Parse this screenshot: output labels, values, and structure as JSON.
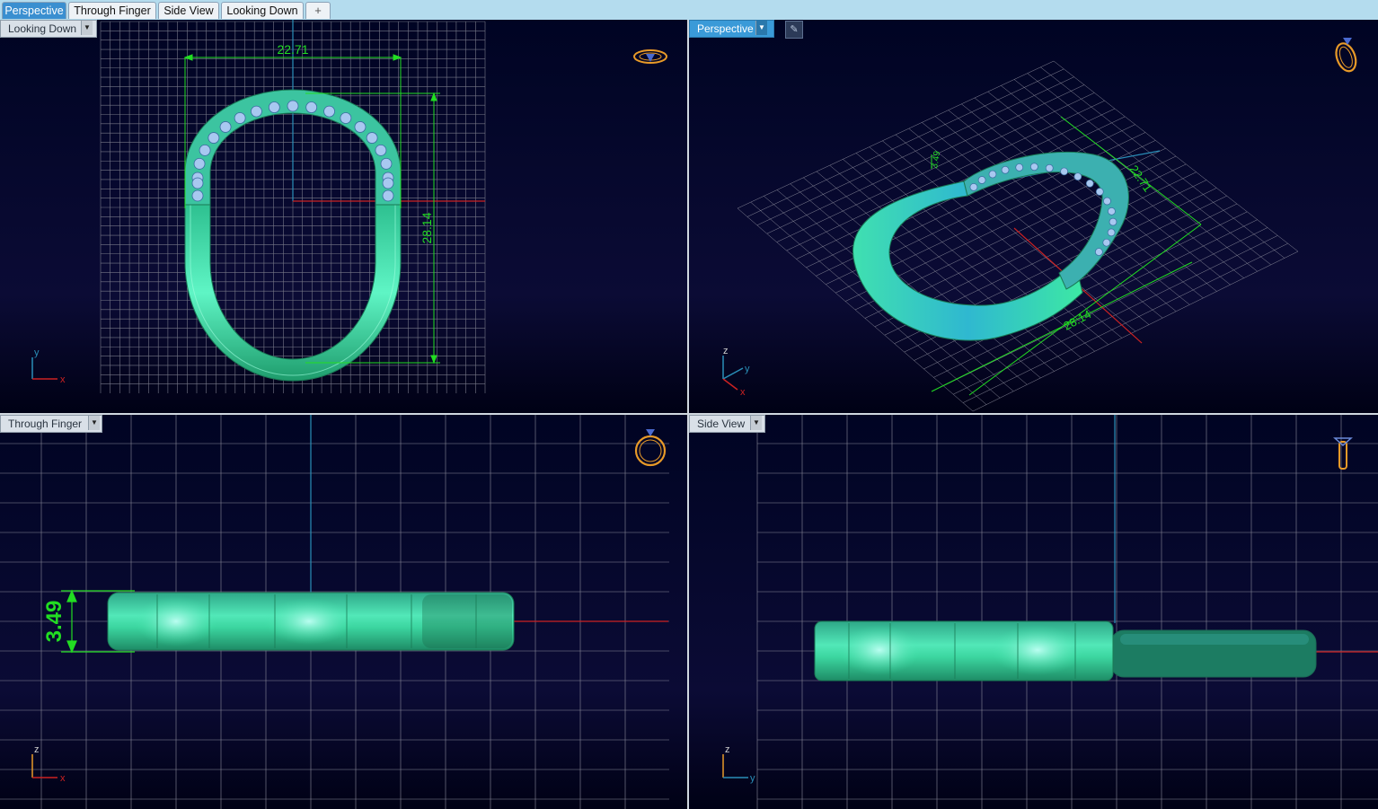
{
  "tabs": [
    {
      "label": "Perspective",
      "active": true
    },
    {
      "label": "Through Finger",
      "active": false
    },
    {
      "label": "Side View",
      "active": false
    },
    {
      "label": "Looking Down",
      "active": false
    }
  ],
  "tab_add_icon": "plus-icon",
  "viewports": {
    "top_left": {
      "label": "Looking Down",
      "dim_width": "22.71",
      "dim_height": "28.14",
      "axis_a": "y",
      "axis_b": "x",
      "active": false
    },
    "top_right": {
      "label": "Perspective",
      "dim_width": "22.71",
      "dim_height": "28.14",
      "dim_small": "3.49",
      "axis_a": "z",
      "axis_b": "y",
      "axis_c": "x",
      "active": true
    },
    "bottom_left": {
      "label": "Through Finger",
      "dim_thickness": "3.49",
      "axis_a": "z",
      "axis_b": "x",
      "active": false
    },
    "bottom_right": {
      "label": "Side View",
      "axis_a": "z",
      "axis_b": "y",
      "active": false
    }
  },
  "colors": {
    "background_top": "#000423",
    "background_bottom": "#000115",
    "grid": "#8a8a9a",
    "dimension": "#22dd22",
    "ring_body": "#38e0a0",
    "ring_gems": "#a8c8f0",
    "axis_x": "#cc2222",
    "axis_y": "#2a8fb8",
    "view_icon": "#e89a28",
    "tab_active": "#3a8fd0"
  },
  "icons": [
    "ring-view-icon",
    "dropdown-arrow-icon",
    "pin-icon",
    "axis-icon"
  ]
}
